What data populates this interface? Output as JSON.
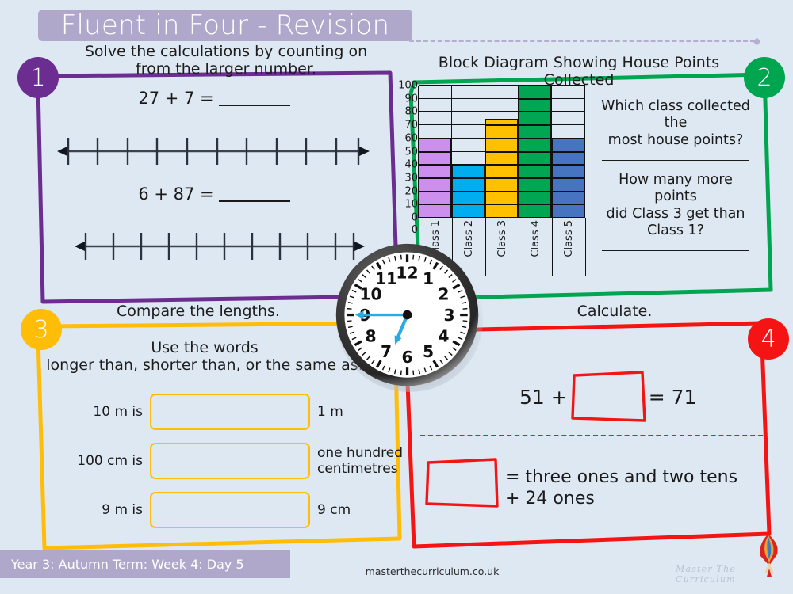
{
  "header": {
    "title": "Fluent in Four - Revision"
  },
  "sections": [
    {
      "number": "1",
      "color": "#6b2d8f",
      "heading": "Solve the calculations by counting on\nfrom the larger number.",
      "calculations": [
        {
          "expression": "27 + 7 =",
          "ticks": 11
        },
        {
          "expression": "6 + 87 =",
          "ticks": 11
        }
      ]
    },
    {
      "number": "2",
      "color": "#00a550",
      "heading": "Block Diagram Showing House Points Collected",
      "questions": [
        "Which class collected the\nmost house points?",
        "How many more points\ndid Class 3 get than\nClass 1?"
      ]
    },
    {
      "number": "3",
      "color": "#ffbd08",
      "heading": "Compare the lengths.",
      "subheading": "Use the words\nlonger than, shorter than, or the same as.",
      "rows": [
        {
          "left": "10 m is",
          "right": "1 m",
          "value": ""
        },
        {
          "left": "100 cm is",
          "right": "one hundred\ncentimetres",
          "value": ""
        },
        {
          "left": "9 m is",
          "right": "9 cm",
          "value": ""
        }
      ]
    },
    {
      "number": "4",
      "color": "#f41414",
      "heading": "Calculate.",
      "equation": {
        "lhs": "51 +",
        "rhs": "= 71",
        "value": ""
      },
      "statement": {
        "text": "= three ones and two tens\n+ 24 ones",
        "value": ""
      }
    }
  ],
  "chart_data": {
    "type": "bar",
    "title": "Block Diagram Showing House Points Collected",
    "categories": [
      "Class 1",
      "Class 2",
      "Class 3",
      "Class 4",
      "Class 5"
    ],
    "values": [
      60,
      40,
      75,
      100,
      60
    ],
    "colors": [
      "#cc8fee",
      "#00aeef",
      "#ffc000",
      "#00a651",
      "#4674c1"
    ],
    "xlabel": "",
    "ylabel": "",
    "ylim": [
      0,
      100
    ],
    "ytick_step": 10,
    "yticks": [
      "100",
      "90",
      "80",
      "70",
      "60",
      "50",
      "40",
      "30",
      "20",
      "10",
      "0"
    ],
    "origin_label": "0",
    "grid": true,
    "legend": "none"
  },
  "clock": {
    "time": "6:45",
    "hour_numbers": [
      "12",
      "1",
      "2",
      "3",
      "4",
      "5",
      "6",
      "7",
      "8",
      "9",
      "10",
      "11"
    ],
    "hand_color": "#29abe2"
  },
  "footer": {
    "term": "Year 3: Autumn Term: Week 4: Day 5",
    "url": "masterthecurriculum.co.uk",
    "brand": "Master The Curriculum"
  }
}
